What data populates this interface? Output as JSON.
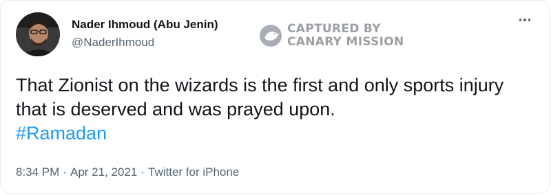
{
  "author": {
    "display_name": "Nader Ihmoud (Abu Jenin)",
    "handle": "@NaderIhmoud",
    "avatar_icon": "profile-photo"
  },
  "watermark": {
    "line1": "CAPTURED BY",
    "line2": "CANARY MISSION",
    "logo_icon": "canary-bird-icon"
  },
  "menu": {
    "icon": "more-horizontal-icon"
  },
  "tweet": {
    "text": "That Zionist on the wizards is the first and only sports injury that is deserved and was prayed upon.",
    "hashtag": "#Ramadan"
  },
  "meta": {
    "time": "8:34 PM",
    "separator": "·",
    "date": "Apr 21, 2021",
    "source": "Twitter for iPhone"
  },
  "colors": {
    "text": "#0f1419",
    "secondary": "#536471",
    "link": "#1d9bf0",
    "watermark": "#8a8f94"
  }
}
